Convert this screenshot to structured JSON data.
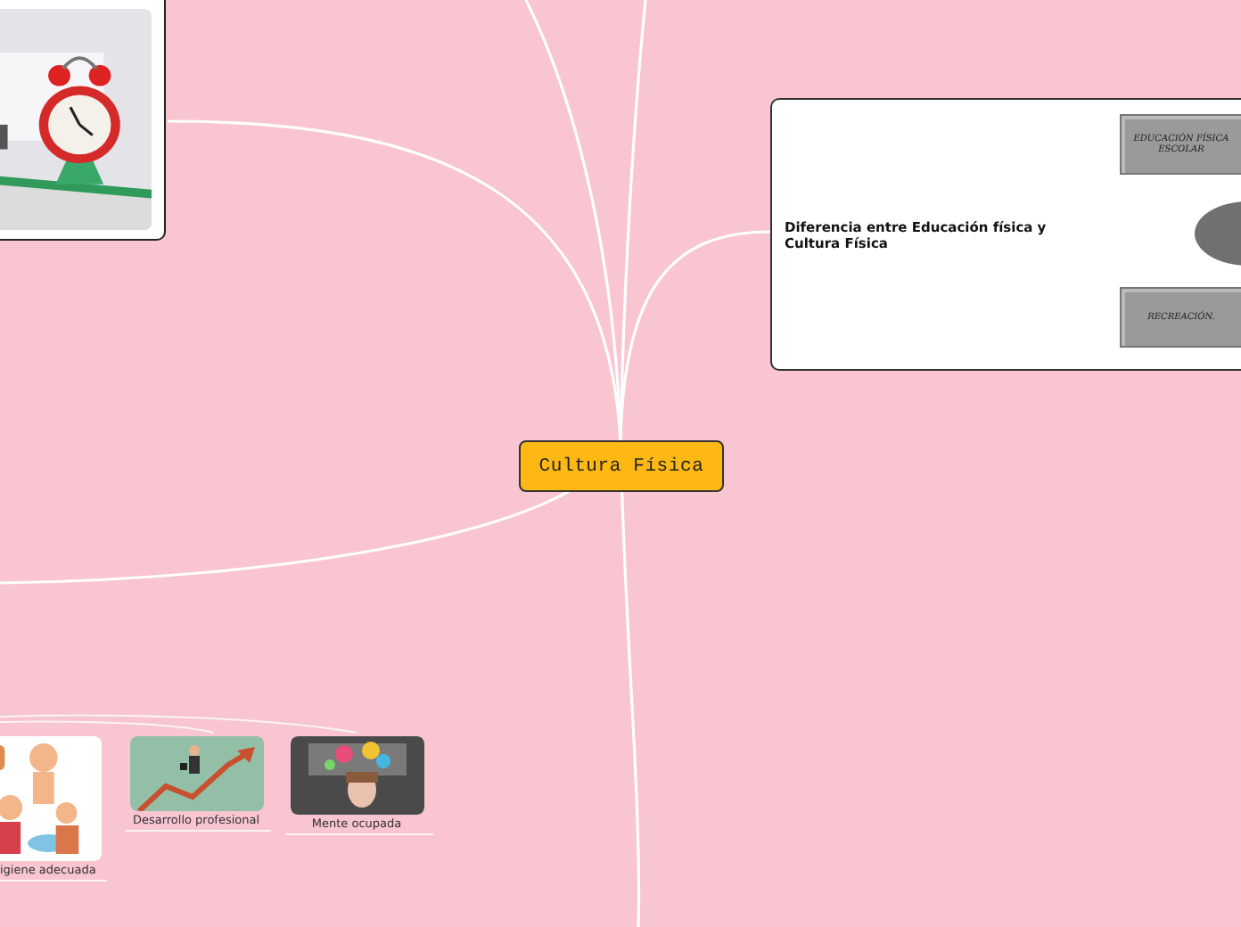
{
  "central_topic": {
    "label": "Cultura Física"
  },
  "comparison_topic": {
    "label": "Diferencia entre Educación física y Cultura Física",
    "diagram_boxes": [
      "EDUCACIÓN FÍSICA ESCOLAR",
      "RECREACIÓN."
    ]
  },
  "image_subtopics": [
    {
      "caption": "igiene adecuada"
    },
    {
      "caption": "Desarrollo profesional"
    },
    {
      "caption": "Mente ocupada"
    }
  ]
}
